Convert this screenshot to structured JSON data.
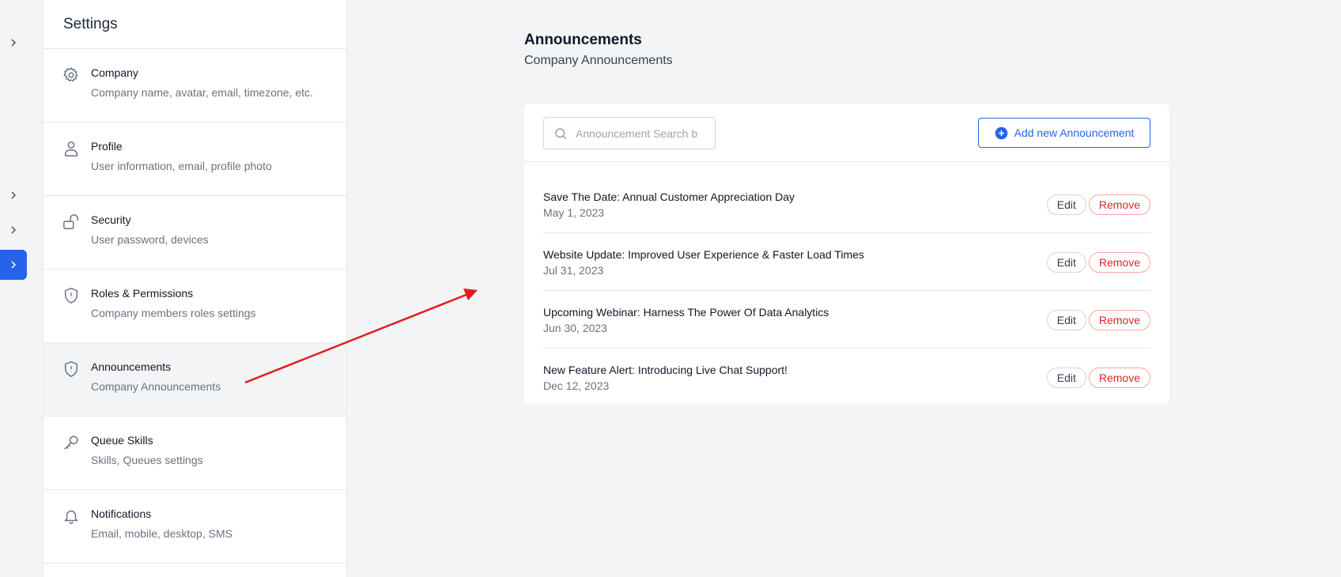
{
  "settings": {
    "title": "Settings",
    "items": [
      {
        "label": "Company",
        "desc": "Company name, avatar, email, timezone, etc.",
        "icon": "gear-icon"
      },
      {
        "label": "Profile",
        "desc": "User information, email, profile photo",
        "icon": "user-icon"
      },
      {
        "label": "Security",
        "desc": "User password, devices",
        "icon": "lock-icon"
      },
      {
        "label": "Roles & Permissions",
        "desc": "Company members roles settings",
        "icon": "shield-icon"
      },
      {
        "label": "Announcements",
        "desc": "Company Announcements",
        "icon": "shield-icon"
      },
      {
        "label": "Queue Skills",
        "desc": "Skills, Queues settings",
        "icon": "key-icon"
      },
      {
        "label": "Notifications",
        "desc": "Email, mobile, desktop, SMS",
        "icon": "bell-icon"
      }
    ],
    "active": "Announcements"
  },
  "main": {
    "title": "Announcements",
    "subtitle": "Company Announcements",
    "search": {
      "placeholder": "Announcement Search b"
    },
    "add_button": "Add new Announcement",
    "announcements": [
      {
        "title": "Save The Date: Annual Customer Appreciation Day",
        "date": "May 1, 2023",
        "edit": "Edit",
        "remove": "Remove"
      },
      {
        "title": "Website Update: Improved User Experience & Faster Load Times",
        "date": "Jul 31, 2023",
        "edit": "Edit",
        "remove": "Remove"
      },
      {
        "title": "Upcoming Webinar: Harness The Power Of Data Analytics",
        "date": "Jun 30, 2023",
        "edit": "Edit",
        "remove": "Remove"
      },
      {
        "title": "New Feature Alert: Introducing Live Chat Support!",
        "date": "Dec 12, 2023",
        "edit": "Edit",
        "remove": "Remove"
      }
    ]
  },
  "colors": {
    "accent": "#2563eb",
    "danger": "#dc2626",
    "annotation_arrow": "#e11d1d"
  }
}
